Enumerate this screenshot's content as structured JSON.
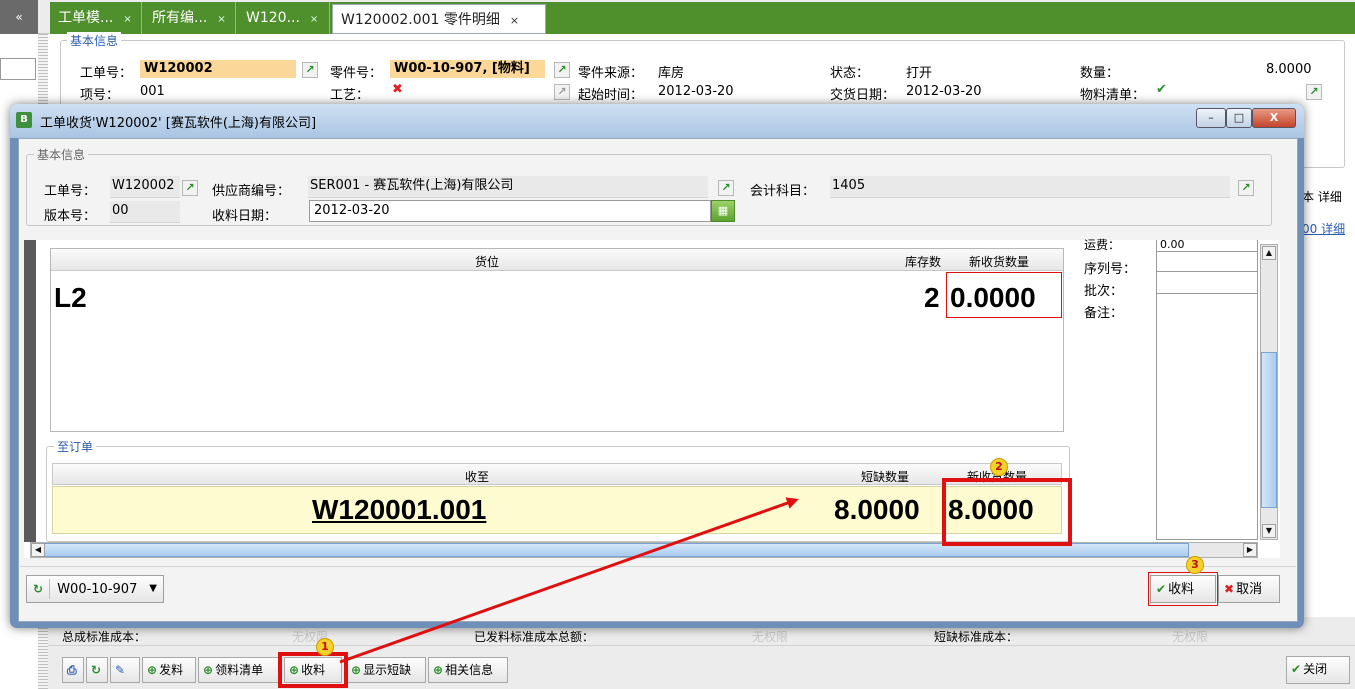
{
  "tabs": {
    "collapse": "«",
    "items": [
      {
        "label": "工单模...",
        "close": "×"
      },
      {
        "label": "所有编...",
        "close": "×"
      },
      {
        "label": "W120...",
        "close": "×"
      },
      {
        "label": "W120002.001 零件明细",
        "close": "×"
      }
    ]
  },
  "bg_info": {
    "legend": "基本信息",
    "workorder_label": "工单号：",
    "workorder_value": "W120002",
    "part_label": "零件号：",
    "part_value": "W00-10-907, [物料]",
    "source_label": "零件来源：",
    "source_value": "库房",
    "status_label": "状态：",
    "status_value": "打开",
    "qty_label": "数量：",
    "qty_value": "8.0000",
    "item_label": "项号：",
    "item_value": "001",
    "process_label": "工艺：",
    "start_label": "起始时间：",
    "start_value": "2012-03-20",
    "delivery_label": "交货日期：",
    "delivery_value": "2012-03-20",
    "bom_label": "物料清单：",
    "right_frag1": "本 详细",
    "right_frag2": "00 详细"
  },
  "dialog": {
    "icon": "B",
    "title": "工单收货'W120002' [赛瓦软件(上海)有限公司]",
    "win_min": "–",
    "win_max": "□",
    "win_close": "X",
    "info": {
      "legend": "基本信息",
      "workorder_label": "工单号：",
      "workorder_value": "W120002",
      "vendor_label": "供应商编号：",
      "vendor_value": "SER001 - 赛瓦软件(上海)有限公司",
      "account_label": "会计科目：",
      "account_value": "1405",
      "version_label": "版本号：",
      "version_value": "00",
      "recv_date_label": "收料日期：",
      "recv_date_value": "2012-03-20"
    },
    "location_grid": {
      "headers": [
        "货位",
        "库存数",
        "新收货数量"
      ],
      "rows": [
        {
          "location": "L2",
          "stock": "2",
          "new_qty": "0.0000"
        }
      ]
    },
    "order_grid": {
      "legend": "至订单",
      "headers": [
        "收至",
        "短缺数量",
        "新收货数量"
      ],
      "rows": [
        {
          "to": "W120001.001",
          "short": "8.0000",
          "new_qty": "8.0000"
        }
      ]
    },
    "right_panel": {
      "freight_label": "运费：",
      "freight_value": "0.00",
      "serial_label": "序列号：",
      "batch_label": "批次：",
      "note_label": "备注："
    },
    "footer": {
      "part_combo": "W00-10-907",
      "receive": "收料",
      "cancel": "取消"
    }
  },
  "bottom": {
    "total_std_cost_label": "总成标准成本：",
    "total_std_cost_value": "无权限",
    "issued_std_cost_label": "已发料标准成本总额：",
    "issued_std_cost_value": "无权限",
    "short_std_cost_label": "短缺标准成本：",
    "short_std_cost_value": "无权限",
    "toolbar": {
      "issue": "发料",
      "pick_list": "领料清单",
      "receive": "收料",
      "show_short": "显示短缺",
      "related": "相关信息",
      "close": "关闭"
    }
  },
  "annotations": {
    "n1": "1",
    "n2": "2",
    "n3": "3"
  },
  "colors": {
    "accent_green": "#4f8f2c",
    "annotation_red": "#e01010",
    "highlight_yellow": "#fefbd0"
  }
}
